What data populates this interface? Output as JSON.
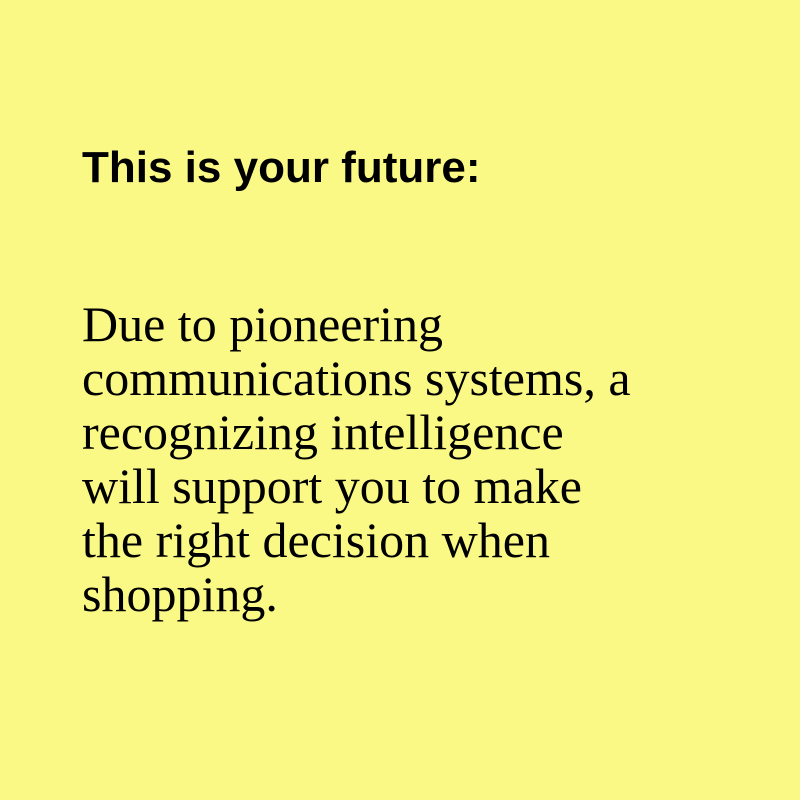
{
  "colors": {
    "background": "#fbf985",
    "text": "#000000"
  },
  "heading": "This is your future:",
  "body_lines": [
    "Due to pioneering",
    "communications systems, a",
    "recognizing intelligence",
    "will support you to make",
    "the right decision when",
    "shopping."
  ]
}
